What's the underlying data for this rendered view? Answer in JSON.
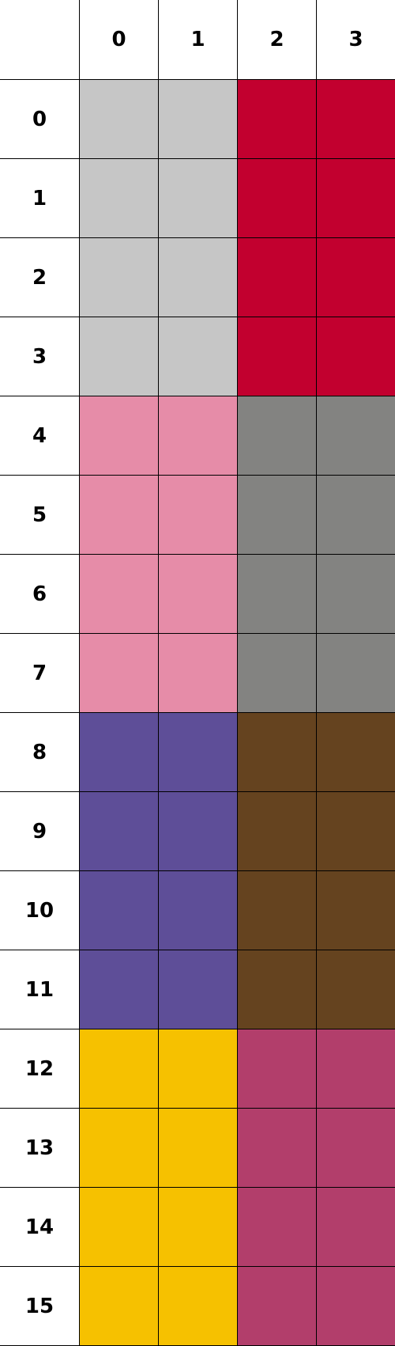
{
  "column_headers": [
    "0",
    "1",
    "2",
    "3"
  ],
  "row_headers": [
    "0",
    "1",
    "2",
    "3",
    "4",
    "5",
    "6",
    "7",
    "8",
    "9",
    "10",
    "11",
    "12",
    "13",
    "14",
    "15"
  ],
  "palette": {
    "light-gray": "#c6c6c6",
    "crimson": "#c2002f",
    "pink": "#e68ca8",
    "gray": "#838381",
    "purple": "#5e4e98",
    "brown": "#65431f",
    "yellow": "#f6c100",
    "raspberry": "#b23e6b"
  },
  "cells": [
    [
      "light-gray",
      "light-gray",
      "crimson",
      "crimson"
    ],
    [
      "light-gray",
      "light-gray",
      "crimson",
      "crimson"
    ],
    [
      "light-gray",
      "light-gray",
      "crimson",
      "crimson"
    ],
    [
      "light-gray",
      "light-gray",
      "crimson",
      "crimson"
    ],
    [
      "pink",
      "pink",
      "gray",
      "gray"
    ],
    [
      "pink",
      "pink",
      "gray",
      "gray"
    ],
    [
      "pink",
      "pink",
      "gray",
      "gray"
    ],
    [
      "pink",
      "pink",
      "gray",
      "gray"
    ],
    [
      "purple",
      "purple",
      "brown",
      "brown"
    ],
    [
      "purple",
      "purple",
      "brown",
      "brown"
    ],
    [
      "purple",
      "purple",
      "brown",
      "brown"
    ],
    [
      "purple",
      "purple",
      "brown",
      "brown"
    ],
    [
      "yellow",
      "yellow",
      "raspberry",
      "raspberry"
    ],
    [
      "yellow",
      "yellow",
      "raspberry",
      "raspberry"
    ],
    [
      "yellow",
      "yellow",
      "raspberry",
      "raspberry"
    ],
    [
      "yellow",
      "yellow",
      "raspberry",
      "raspberry"
    ]
  ]
}
